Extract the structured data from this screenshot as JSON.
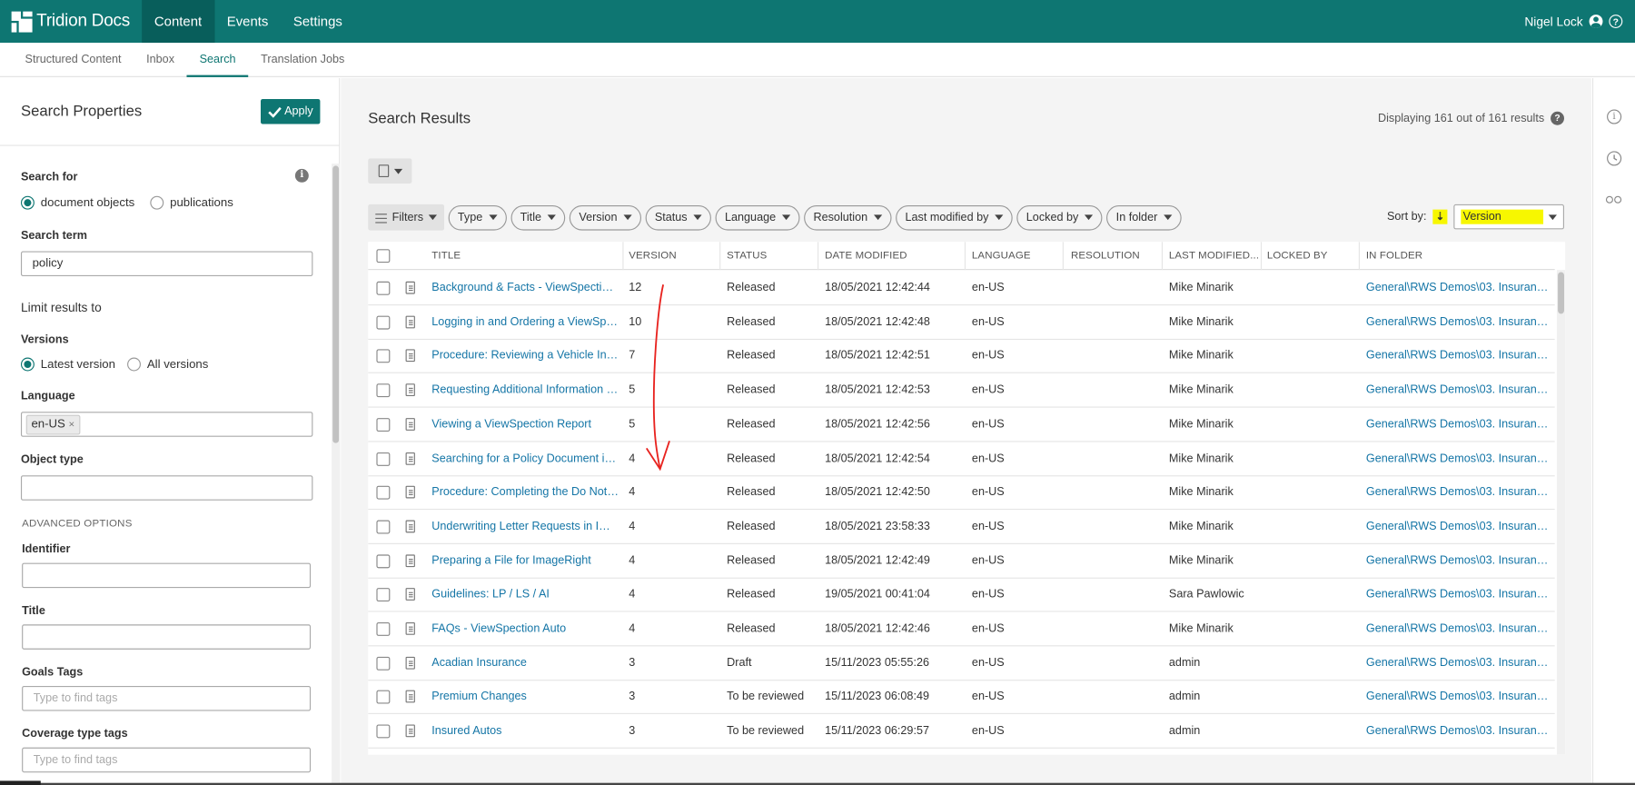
{
  "app": {
    "brand": "Tridion Docs",
    "nav": [
      "Content",
      "Events",
      "Settings"
    ],
    "active_nav": "Content",
    "user": "Nigel Lock"
  },
  "subnav": [
    "Structured Content",
    "Inbox",
    "Search",
    "Translation Jobs"
  ],
  "active_subnav": "Search",
  "left_panel": {
    "title": "Search Properties",
    "apply_label": "Apply",
    "search_for_label": "Search for",
    "search_for_options": [
      "document objects",
      "publications"
    ],
    "search_for_selected": "document objects",
    "search_term_label": "Search term",
    "search_term_value": "policy",
    "limit_label": "Limit results to",
    "versions_label": "Versions",
    "versions_options": [
      "Latest version",
      "All versions"
    ],
    "versions_selected": "Latest version",
    "language_label": "Language",
    "language_tag": "en-US",
    "object_type_label": "Object type",
    "advanced_label": "ADVANCED OPTIONS",
    "identifier_label": "Identifier",
    "title_label": "Title",
    "goals_tags_label": "Goals Tags",
    "goals_tags_placeholder": "Type to find tags",
    "coverage_tags_label": "Coverage type tags",
    "coverage_tags_placeholder": "Type to find tags"
  },
  "main": {
    "title": "Search Results",
    "display_count": "Displaying 161 out of 161 results",
    "filters_label": "Filters",
    "filter_pills": [
      "Type",
      "Title",
      "Version",
      "Status",
      "Language",
      "Resolution",
      "Last modified by",
      "Locked by",
      "In folder"
    ],
    "sort_by_label": "Sort by:",
    "sort_value": "Version",
    "highlight_color": "#f7f700",
    "accent_color": "#0e7672"
  },
  "table": {
    "columns": [
      "TITLE",
      "VERSION",
      "STATUS",
      "DATE MODIFIED",
      "LANGUAGE",
      "RESOLUTION",
      "LAST MODIFIED...",
      "LOCKED BY",
      "IN FOLDER"
    ],
    "rows": [
      {
        "title": "Background & Facts - ViewSpection ...",
        "version": "12",
        "status": "Released",
        "date": "18/05/2021 12:42:44",
        "language": "en-US",
        "resolution": "",
        "modified_by": "Mike Minarik",
        "locked_by": "",
        "folder": "General\\RWS Demos\\03. Insurance..."
      },
      {
        "title": "Logging in and Ordering a ViewSpec...",
        "version": "10",
        "status": "Released",
        "date": "18/05/2021 12:42:48",
        "language": "en-US",
        "resolution": "",
        "modified_by": "Mike Minarik",
        "locked_by": "",
        "folder": "General\\RWS Demos\\03. Insurance..."
      },
      {
        "title": "Procedure: Reviewing a Vehicle Insp...",
        "version": "7",
        "status": "Released",
        "date": "18/05/2021 12:42:51",
        "language": "en-US",
        "resolution": "",
        "modified_by": "Mike Minarik",
        "locked_by": "",
        "folder": "General\\RWS Demos\\03. Insurance..."
      },
      {
        "title": "Requesting Additional Information a...",
        "version": "5",
        "status": "Released",
        "date": "18/05/2021 12:42:53",
        "language": "en-US",
        "resolution": "",
        "modified_by": "Mike Minarik",
        "locked_by": "",
        "folder": "General\\RWS Demos\\03. Insurance..."
      },
      {
        "title": "Viewing a ViewSpection Report",
        "version": "5",
        "status": "Released",
        "date": "18/05/2021 12:42:56",
        "language": "en-US",
        "resolution": "",
        "modified_by": "Mike Minarik",
        "locked_by": "",
        "folder": "General\\RWS Demos\\03. Insurance..."
      },
      {
        "title": "Searching for a Policy Document in I...",
        "version": "4",
        "status": "Released",
        "date": "18/05/2021 12:42:54",
        "language": "en-US",
        "resolution": "",
        "modified_by": "Mike Minarik",
        "locked_by": "",
        "folder": "General\\RWS Demos\\03. Insurance..."
      },
      {
        "title": "Procedure: Completing the Do Not ...",
        "version": "4",
        "status": "Released",
        "date": "18/05/2021 12:42:50",
        "language": "en-US",
        "resolution": "",
        "modified_by": "Mike Minarik",
        "locked_by": "",
        "folder": "General\\RWS Demos\\03. Insurance..."
      },
      {
        "title": "Underwriting Letter Requests in Ima...",
        "version": "4",
        "status": "Released",
        "date": "18/05/2021 23:58:33",
        "language": "en-US",
        "resolution": "",
        "modified_by": "Mike Minarik",
        "locked_by": "",
        "folder": "General\\RWS Demos\\03. Insurance..."
      },
      {
        "title": "Preparing a File for ImageRight",
        "version": "4",
        "status": "Released",
        "date": "18/05/2021 12:42:49",
        "language": "en-US",
        "resolution": "",
        "modified_by": "Mike Minarik",
        "locked_by": "",
        "folder": "General\\RWS Demos\\03. Insurance..."
      },
      {
        "title": "Guidelines: LP / LS / AI",
        "version": "4",
        "status": "Released",
        "date": "19/05/2021 00:41:04",
        "language": "en-US",
        "resolution": "",
        "modified_by": "Sara Pawlowic",
        "locked_by": "",
        "folder": "General\\RWS Demos\\03. Insurance..."
      },
      {
        "title": "FAQs - ViewSpection Auto",
        "version": "4",
        "status": "Released",
        "date": "18/05/2021 12:42:46",
        "language": "en-US",
        "resolution": "",
        "modified_by": "Mike Minarik",
        "locked_by": "",
        "folder": "General\\RWS Demos\\03. Insurance..."
      },
      {
        "title": "Acadian Insurance",
        "version": "3",
        "status": "Draft",
        "date": "15/11/2023 05:55:26",
        "language": "en-US",
        "resolution": "",
        "modified_by": "admin",
        "locked_by": "",
        "folder": "General\\RWS Demos\\03. Insurance..."
      },
      {
        "title": "Premium Changes",
        "version": "3",
        "status": "To be reviewed",
        "date": "15/11/2023 06:08:49",
        "language": "en-US",
        "resolution": "",
        "modified_by": "admin",
        "locked_by": "",
        "folder": "General\\RWS Demos\\03. Insurance..."
      },
      {
        "title": "Insured Autos",
        "version": "3",
        "status": "To be reviewed",
        "date": "15/11/2023 06:29:57",
        "language": "en-US",
        "resolution": "",
        "modified_by": "admin",
        "locked_by": "",
        "folder": "General\\RWS Demos\\03. Insurance..."
      }
    ]
  },
  "rail_icons": [
    "info-icon",
    "history-icon",
    "binoculars-icon"
  ],
  "annotation": {
    "color": "#e8231f"
  }
}
